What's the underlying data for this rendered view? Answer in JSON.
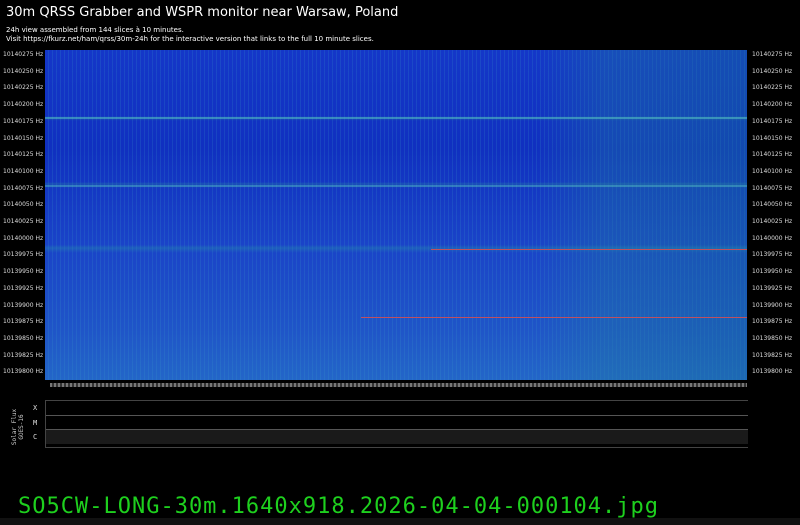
{
  "header": {
    "title": "30m QRSS Grabber and WSPR monitor near Warsaw, Poland",
    "line1": "24h view assembled from 144 slices à 10 minutes.",
    "line2": "Visit https://fkurz.net/ham/qrss/30m-24h for the interactive version that links to the full 10 minute slices."
  },
  "y_labels": [
    "10140275 Hz",
    "10140250 Hz",
    "10140225 Hz",
    "10140200 Hz",
    "10140175 Hz",
    "10140150 Hz",
    "10140125 Hz",
    "10140100 Hz",
    "10140075 Hz",
    "10140050 Hz",
    "10140025 Hz",
    "10140000 Hz",
    "10139975 Hz",
    "10139950 Hz",
    "10139925 Hz",
    "10139900 Hz",
    "10139875 Hz",
    "10139850 Hz",
    "10139825 Hz",
    "10139800 Hz"
  ],
  "flux": {
    "label1": "Solar Flux",
    "label2": "GOES-16",
    "classes": [
      "X",
      "M",
      "C"
    ]
  },
  "filename": "SO5CW-LONG-30m.1640x918.2026-04-04-000104.jpg",
  "colors": {
    "signal": "#1437c8",
    "filename": "#1ed01e"
  }
}
